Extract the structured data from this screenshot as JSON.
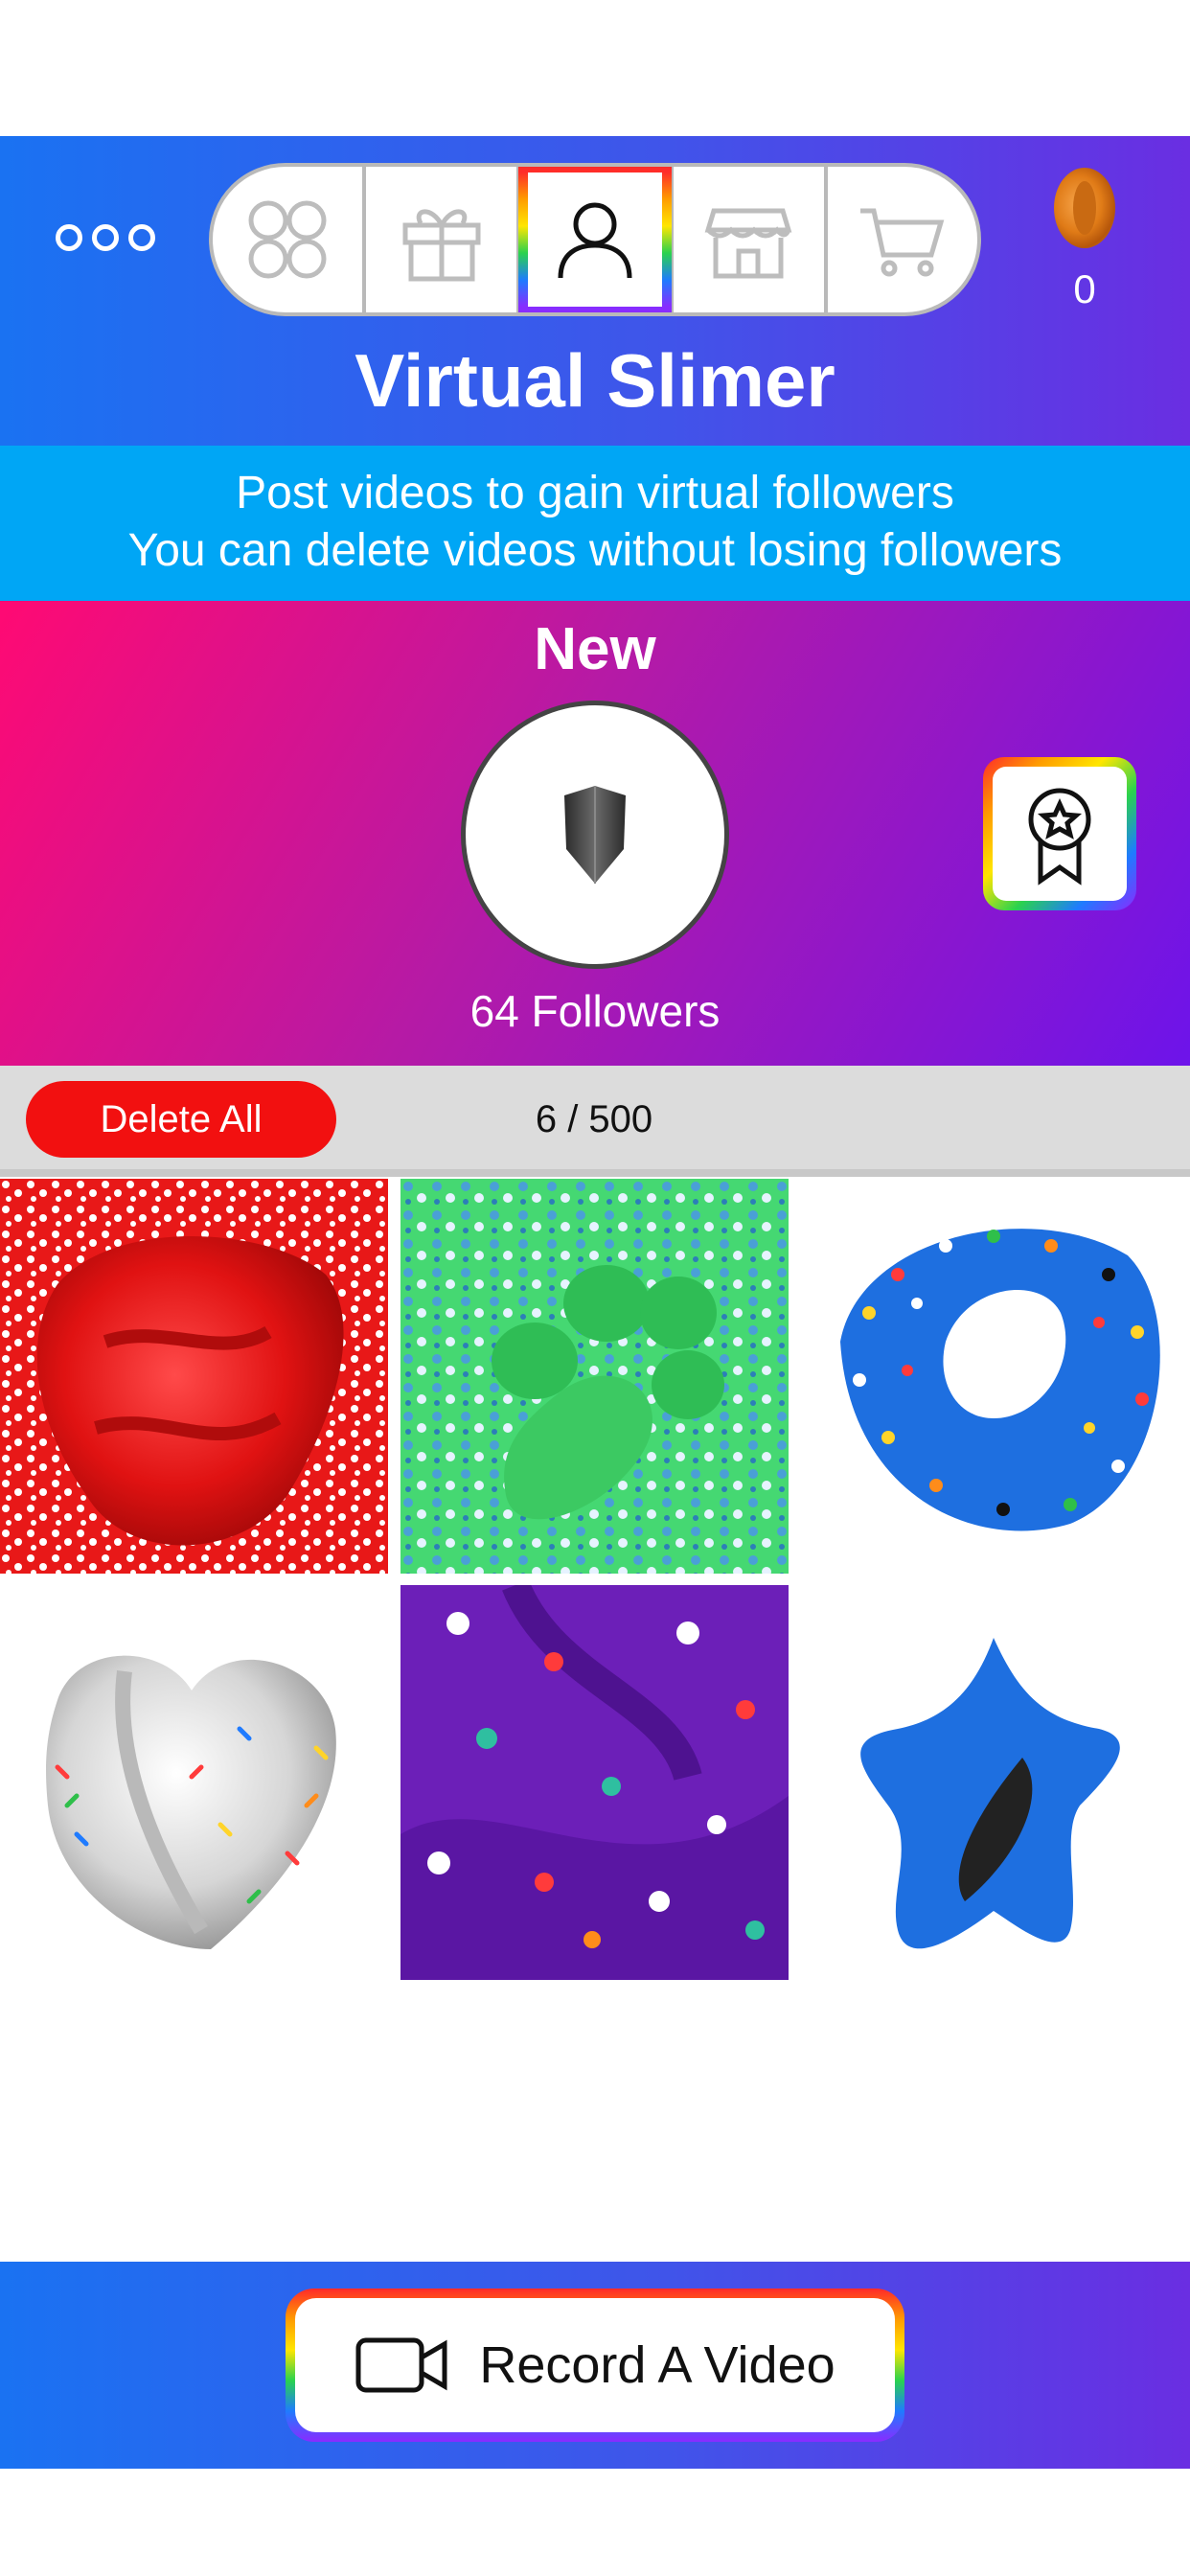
{
  "header": {
    "title": "Virtual Slimer",
    "coins": "0",
    "tabs": [
      {
        "name": "collection",
        "icon": "four-circles-icon"
      },
      {
        "name": "gifts",
        "icon": "gift-icon"
      },
      {
        "name": "profile",
        "icon": "user-icon",
        "active": true
      },
      {
        "name": "shop",
        "icon": "storefront-icon"
      },
      {
        "name": "cart",
        "icon": "cart-icon"
      }
    ]
  },
  "info": {
    "line1": "Post videos to gain virtual followers",
    "line2": "You can delete videos without losing followers"
  },
  "profile": {
    "rank": "New",
    "followers": "64 Followers"
  },
  "toolbar": {
    "delete_label": "Delete All",
    "count": "6 / 500"
  },
  "videos": [
    {
      "name": "red-slime-thumbnail"
    },
    {
      "name": "green-slime-thumbnail"
    },
    {
      "name": "blue-donut-slime-thumbnail"
    },
    {
      "name": "white-heart-slime-thumbnail"
    },
    {
      "name": "purple-slime-thumbnail"
    },
    {
      "name": "blue-star-slime-thumbnail"
    }
  ],
  "record": {
    "label": "Record A Video"
  }
}
